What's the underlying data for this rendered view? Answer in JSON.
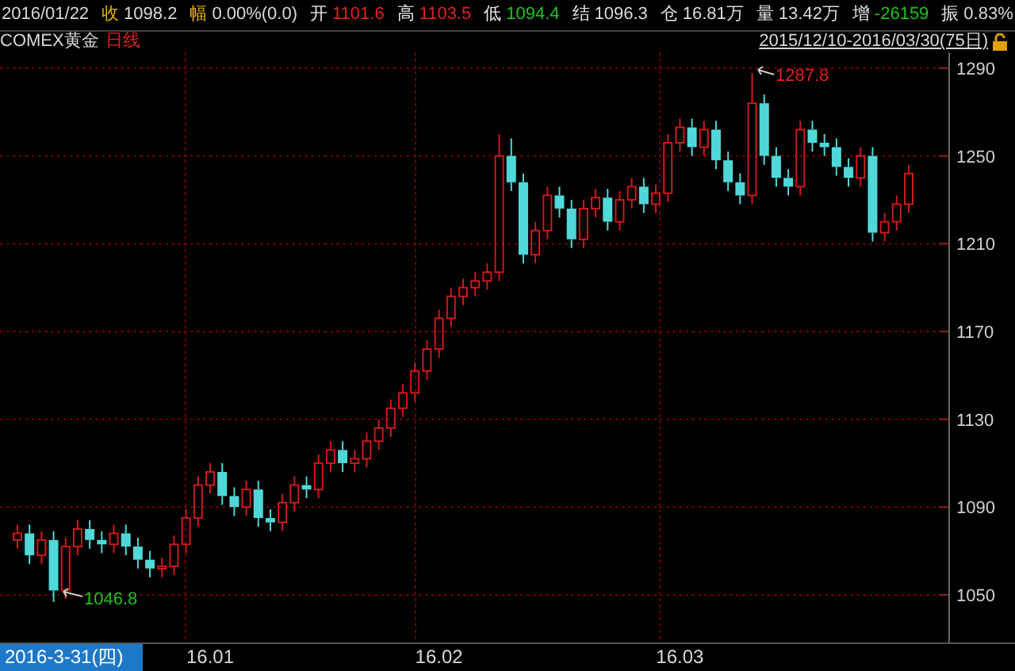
{
  "quote_bar": {
    "date": "2016/01/22",
    "fields": [
      {
        "label": "收",
        "value": "1098.2",
        "label_accent": true,
        "color": "#d8d8d8"
      },
      {
        "label": "幅",
        "value": "0.00%(0.0)",
        "label_accent": true,
        "color": "#d8d8d8"
      },
      {
        "label": "开",
        "value": "1101.6",
        "label_accent": false,
        "color": "#e02020"
      },
      {
        "label": "高",
        "value": "1103.5",
        "label_accent": false,
        "color": "#e02020"
      },
      {
        "label": "低",
        "value": "1094.4",
        "label_accent": false,
        "color": "#20c020"
      },
      {
        "label": "结",
        "value": "1096.3",
        "label_accent": false,
        "color": "#d8d8d8"
      },
      {
        "label": "仓",
        "value": "16.81万",
        "label_accent": false,
        "color": "#d8d8d8"
      },
      {
        "label": "量",
        "value": "13.42万",
        "label_accent": false,
        "color": "#d8d8d8"
      },
      {
        "label": "增",
        "value": "-26159",
        "label_accent": false,
        "color": "#20c020"
      },
      {
        "label": "振",
        "value": "0.83%",
        "label_accent": false,
        "color": "#d8d8d8"
      }
    ]
  },
  "chart_header": {
    "symbol": "COMEX黄金",
    "period": "日线",
    "range": "2015/12/10-2016/03/30(75日)"
  },
  "chart": {
    "high_marker": "1287.8",
    "low_marker": "1046.8",
    "chart_data": {
      "type": "candlestick",
      "grid": true,
      "ylim": [
        1028.3,
        1297.2
      ],
      "yticks": [
        1290,
        1250,
        1210,
        1170,
        1130,
        1090,
        1050
      ],
      "categories": [
        null,
        null,
        null,
        null,
        null,
        null,
        null,
        null,
        null,
        null,
        null,
        null,
        null,
        null,
        null,
        null,
        "16.01",
        null,
        null,
        null,
        null,
        null,
        null,
        null,
        null,
        null,
        null,
        null,
        null,
        null,
        null,
        null,
        null,
        null,
        null,
        "16.02",
        null,
        null,
        null,
        null,
        null,
        null,
        null,
        null,
        null,
        null,
        null,
        null,
        null,
        null,
        null,
        null,
        null,
        null,
        null,
        "16.03",
        null,
        null,
        null,
        null,
        null,
        null,
        null,
        null,
        null,
        null,
        null,
        null,
        null,
        null,
        null,
        null,
        null,
        null,
        null
      ],
      "ohlc": [
        [
          1075,
          1082,
          1071,
          1078
        ],
        [
          1078,
          1082,
          1064,
          1068
        ],
        [
          1068,
          1079,
          1064,
          1075
        ],
        [
          1075,
          1079,
          1046.8,
          1052
        ],
        [
          1052,
          1076,
          1048,
          1072
        ],
        [
          1072,
          1084,
          1068,
          1080
        ],
        [
          1080,
          1084,
          1071,
          1075
        ],
        [
          1075,
          1079,
          1069,
          1073
        ],
        [
          1073,
          1082,
          1069,
          1078
        ],
        [
          1078,
          1082,
          1068,
          1072
        ],
        [
          1072,
          1076,
          1062,
          1066
        ],
        [
          1066,
          1070,
          1058,
          1062
        ],
        [
          1062,
          1067,
          1058,
          1063
        ],
        [
          1063,
          1077,
          1059,
          1073
        ],
        [
          1073,
          1089,
          1069,
          1085
        ],
        [
          1085,
          1104,
          1081,
          1100
        ],
        [
          1100,
          1110,
          1096,
          1106
        ],
        [
          1106,
          1110,
          1091,
          1095
        ],
        [
          1095,
          1099,
          1086,
          1090
        ],
        [
          1090,
          1102,
          1086,
          1098
        ],
        [
          1098,
          1102,
          1081,
          1085
        ],
        [
          1085,
          1089,
          1079,
          1083
        ],
        [
          1083,
          1096,
          1079,
          1092
        ],
        [
          1092,
          1104,
          1088,
          1100
        ],
        [
          1100,
          1104,
          1094,
          1098
        ],
        [
          1098,
          1114,
          1094,
          1110
        ],
        [
          1110,
          1120,
          1106,
          1116
        ],
        [
          1116,
          1120,
          1106,
          1110
        ],
        [
          1110,
          1116,
          1106,
          1112
        ],
        [
          1112,
          1124,
          1108,
          1120
        ],
        [
          1120,
          1130,
          1116,
          1126
        ],
        [
          1126,
          1139,
          1122,
          1135
        ],
        [
          1135,
          1146,
          1131,
          1142
        ],
        [
          1142,
          1156,
          1138,
          1152
        ],
        [
          1152,
          1166,
          1148,
          1162
        ],
        [
          1162,
          1180,
          1158,
          1176
        ],
        [
          1176,
          1190,
          1172,
          1186
        ],
        [
          1186,
          1194,
          1182,
          1190
        ],
        [
          1190,
          1197,
          1186,
          1193
        ],
        [
          1193,
          1201,
          1189,
          1197
        ],
        [
          1197,
          1260,
          1193,
          1250
        ],
        [
          1250,
          1258,
          1234,
          1238
        ],
        [
          1238,
          1242,
          1201,
          1205
        ],
        [
          1205,
          1220,
          1201,
          1216
        ],
        [
          1216,
          1236,
          1212,
          1232
        ],
        [
          1232,
          1236,
          1222,
          1226
        ],
        [
          1226,
          1230,
          1208,
          1212
        ],
        [
          1212,
          1230,
          1208,
          1226
        ],
        [
          1226,
          1235,
          1222,
          1231
        ],
        [
          1231,
          1235,
          1216,
          1220
        ],
        [
          1220,
          1234,
          1216,
          1230
        ],
        [
          1230,
          1240,
          1226,
          1236
        ],
        [
          1236,
          1240,
          1224,
          1228
        ],
        [
          1228,
          1237,
          1224,
          1233
        ],
        [
          1233,
          1260,
          1229,
          1256
        ],
        [
          1256,
          1267,
          1252,
          1263
        ],
        [
          1263,
          1267,
          1250,
          1254
        ],
        [
          1254,
          1266,
          1250,
          1262
        ],
        [
          1262,
          1266,
          1244,
          1248
        ],
        [
          1248,
          1252,
          1234,
          1238
        ],
        [
          1238,
          1242,
          1228,
          1232
        ],
        [
          1232,
          1287.8,
          1228,
          1274
        ],
        [
          1274,
          1278,
          1246,
          1250
        ],
        [
          1250,
          1254,
          1236,
          1240
        ],
        [
          1240,
          1244,
          1232,
          1236
        ],
        [
          1236,
          1266,
          1232,
          1262
        ],
        [
          1262,
          1266,
          1252,
          1256
        ],
        [
          1256,
          1260,
          1250,
          1254
        ],
        [
          1254,
          1258,
          1241,
          1245
        ],
        [
          1245,
          1249,
          1236,
          1240
        ],
        [
          1240,
          1254,
          1236,
          1250
        ],
        [
          1250,
          1254,
          1211,
          1215
        ],
        [
          1215,
          1224,
          1211,
          1220
        ],
        [
          1220,
          1232,
          1216,
          1228
        ],
        [
          1228,
          1246,
          1224,
          1242
        ]
      ]
    }
  },
  "time_axis": {
    "cursor_date": "2016-3-31(四)"
  }
}
